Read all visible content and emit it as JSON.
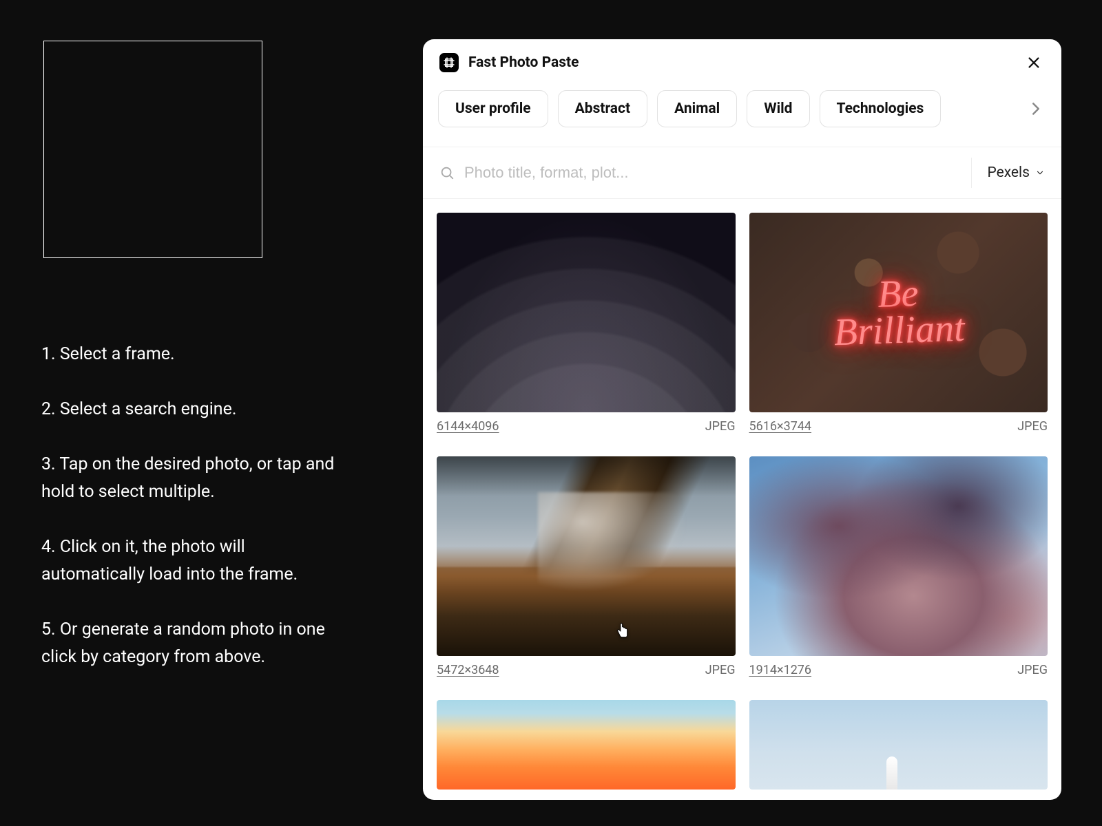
{
  "instructions": [
    "1. Select a frame.",
    "2. Select a search engine.",
    "3. Tap on the desired photo, or tap and hold to select multiple.",
    "4. Click on it, the photo will automatically load into the frame.",
    "5. Or generate a random photo in one click by category from above."
  ],
  "dialog": {
    "title": "Fast Photo Paste",
    "categories": [
      "User profile",
      "Abstract",
      "Animal",
      "Wild",
      "Technologies"
    ],
    "search": {
      "placeholder": "Photo title, format, plot..."
    },
    "source": "Pexels",
    "photos": [
      {
        "dimensions": "6144×4096",
        "format": "JPEG",
        "neon_text": ""
      },
      {
        "dimensions": "5616×3744",
        "format": "JPEG",
        "neon_text": "Be\nBrilliant"
      },
      {
        "dimensions": "5472×3648",
        "format": "JPEG",
        "neon_text": ""
      },
      {
        "dimensions": "1914×1276",
        "format": "JPEG",
        "neon_text": ""
      }
    ]
  }
}
